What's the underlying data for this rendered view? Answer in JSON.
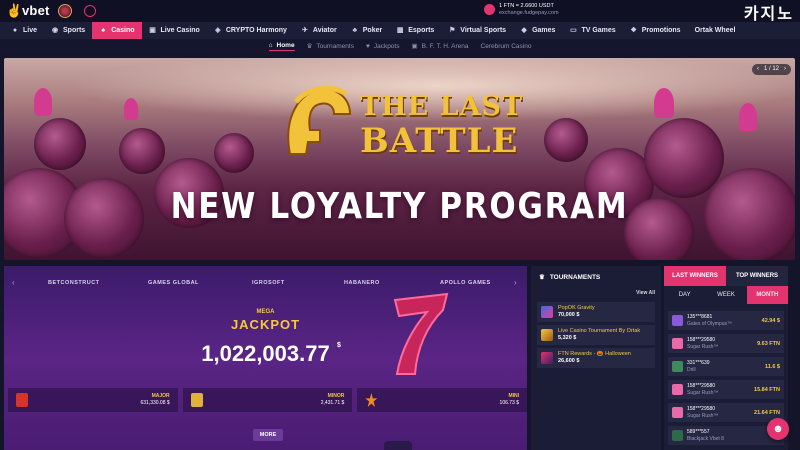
{
  "header": {
    "logo_text": "vbet",
    "rate_line1": "1 FTN = 2.6600 USDT",
    "rate_line2": "exchange.fudgepay.com",
    "brand_korean": "카지노"
  },
  "nav": {
    "items": [
      {
        "label": "Live",
        "icon": "live-icon",
        "glyph": "●"
      },
      {
        "label": "Sports",
        "icon": "sports-ball-icon",
        "glyph": "◉"
      },
      {
        "label": "Casino",
        "icon": "casino-cards-icon",
        "glyph": "♠"
      },
      {
        "label": "Live Casino",
        "icon": "live-casino-icon",
        "glyph": "▣"
      },
      {
        "label": "CRYPTO Harmony",
        "icon": "crypto-icon",
        "glyph": "◈"
      },
      {
        "label": "Aviator",
        "icon": "aviator-plane-icon",
        "glyph": "✈"
      },
      {
        "label": "Poker",
        "icon": "poker-chip-icon",
        "glyph": "♣"
      },
      {
        "label": "Esports",
        "icon": "esports-gamepad-icon",
        "glyph": "▦"
      },
      {
        "label": "Virtual Sports",
        "icon": "virtual-sports-icon",
        "glyph": "⚑"
      },
      {
        "label": "Games",
        "icon": "games-icon",
        "glyph": "◆"
      },
      {
        "label": "TV Games",
        "icon": "tv-games-icon",
        "glyph": "▭"
      },
      {
        "label": "Promotions",
        "icon": "promotions-gift-icon",
        "glyph": "❖"
      },
      {
        "label": "Ortak Wheel",
        "icon": "",
        "glyph": ""
      }
    ]
  },
  "subnav": {
    "items": [
      {
        "label": "Home",
        "glyph": "⌂"
      },
      {
        "label": "Tournaments",
        "glyph": "♛"
      },
      {
        "label": "Jackpots",
        "glyph": "♥"
      },
      {
        "label": "B. F. T. H. Arena",
        "glyph": "▣"
      },
      {
        "label": "Cerebrum Casino",
        "glyph": ""
      }
    ]
  },
  "hero": {
    "title_line1": "THE LAST",
    "title_line2": "BATTLE",
    "headline": "NEW LOYALTY PROGRAM",
    "pager": "1 / 12",
    "pager_prev": "‹",
    "pager_next": "›"
  },
  "jackpot": {
    "providers": [
      "BETCONSTRUCT",
      "GAMES GLOBAL",
      "IGROSOFT",
      "HABANERO",
      "APOLLO GAMES"
    ],
    "prev": "‹",
    "next": "›",
    "mega": "MEGA",
    "label": "JACKPOT",
    "value": "1,022,003.77",
    "currency": "$",
    "tiers": [
      {
        "name": "MAJOR",
        "amount": "631,330.08 $"
      },
      {
        "name": "MINOR",
        "amount": "2,431.71 $"
      },
      {
        "name": "MINI",
        "amount": "106.73 $"
      }
    ],
    "more_label": "MORE"
  },
  "tournaments": {
    "title": "TOURNAMENTS",
    "view_all": "View All",
    "items": [
      {
        "name": "PopOK Gravity",
        "amount": "70,000 $"
      },
      {
        "name": "Live Casino Tournament By Ortak",
        "amount": "5,320 $"
      },
      {
        "name": "FTN Rewards - 🎃 Halloween",
        "amount": "26,600 $"
      }
    ]
  },
  "winners": {
    "tabs": [
      "LAST WINNERS",
      "TOP WINNERS"
    ],
    "periods": [
      "DAY",
      "WEEK",
      "MONTH"
    ],
    "rows": [
      {
        "user": "135***8681",
        "game": "Gates of Olympus™",
        "amount": "42.94 $"
      },
      {
        "user": "158***29580",
        "game": "Sugar Rush™",
        "amount": "9.63 FTN"
      },
      {
        "user": "331***639",
        "game": "Drill",
        "amount": "11.6 $"
      },
      {
        "user": "158***29580",
        "game": "Sugar Rush™",
        "amount": "15.84 FTN"
      },
      {
        "user": "158***29580",
        "game": "Sugar Rush™",
        "amount": "21.64 FTN"
      },
      {
        "user": "589***557",
        "game": "Blackjack Vbet 8",
        "amount": ""
      }
    ]
  },
  "colors": {
    "accent": "#e4346f",
    "gold": "#f6c93c",
    "nav_bg": "#1c1e38",
    "panel_bg": "#1b1c35"
  }
}
